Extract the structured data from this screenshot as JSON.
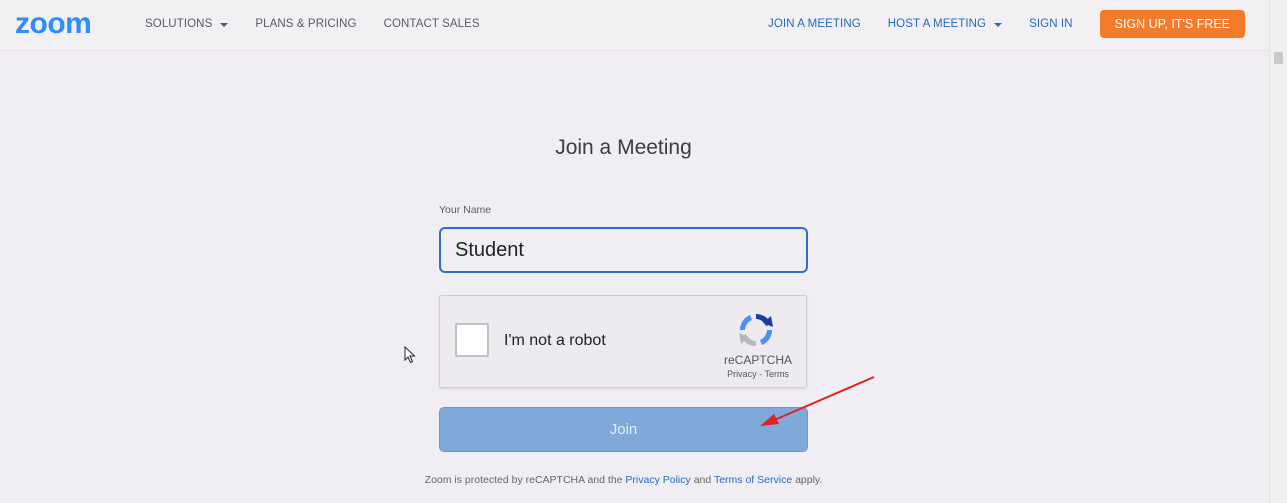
{
  "header": {
    "logo": "zoom",
    "nav_left": [
      "SOLUTIONS",
      "PLANS & PRICING",
      "CONTACT SALES"
    ],
    "nav_right": [
      "JOIN A MEETING",
      "HOST A MEETING",
      "SIGN IN"
    ],
    "signup_label": "SIGN UP, IT'S FREE"
  },
  "main": {
    "title": "Join a Meeting",
    "name_label": "Your Name",
    "name_value": "Student",
    "recaptcha": {
      "checkbox_label": "I'm not a robot",
      "brand": "reCAPTCHA",
      "privacy": "Privacy",
      "separator": "-",
      "terms": "Terms"
    },
    "join_label": "Join",
    "footer": {
      "prefix": "Zoom is protected by reCAPTCHA and the",
      "privacy_link": "Privacy Policy",
      "and": "and",
      "terms_link": "Terms of Service",
      "suffix": "apply."
    }
  },
  "colors": {
    "brand_blue": "#2d8cff",
    "nav_blue": "#2369c4",
    "signup_orange": "#f47b2a",
    "join_button": "#7fa9d8",
    "annotation_arrow": "#e0221f"
  },
  "icons": [
    "caret-down-icon",
    "recaptcha-logo-icon",
    "mouse-cursor-icon",
    "annotation-arrow-icon"
  ]
}
